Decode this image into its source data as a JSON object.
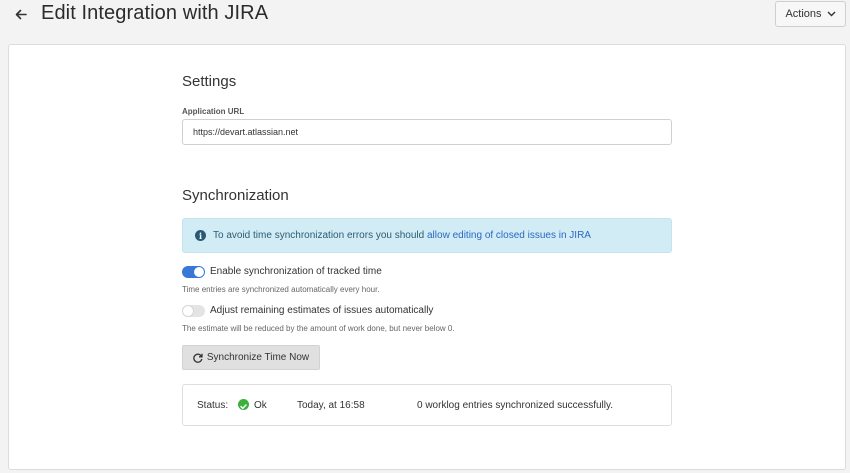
{
  "header": {
    "title": "Edit Integration with JIRA",
    "actions_label": "Actions"
  },
  "settings": {
    "title": "Settings",
    "app_url_label": "Application URL",
    "app_url_value": "https://devart.atlassian.net"
  },
  "sync": {
    "title": "Synchronization",
    "info_text": "To avoid time synchronization errors you should ",
    "info_link": "allow editing of closed issues in JIRA",
    "toggle1_label": "Enable synchronization of tracked time",
    "toggle1_on": true,
    "toggle1_help": "Time entries are synchronized automatically every hour.",
    "toggle2_label": "Adjust remaining estimates of issues automatically",
    "toggle2_on": false,
    "toggle2_help": "The estimate will be reduced by the amount of work done, but never below 0.",
    "sync_button": "Synchronize Time Now"
  },
  "status": {
    "label": "Status:",
    "value": "Ok",
    "time": "Today, at 16:58",
    "message": "0 worklog entries synchronized successfully."
  },
  "colors": {
    "accent": "#3a78d8",
    "info_bg": "#d2ecf5",
    "success": "#3bb03b"
  }
}
